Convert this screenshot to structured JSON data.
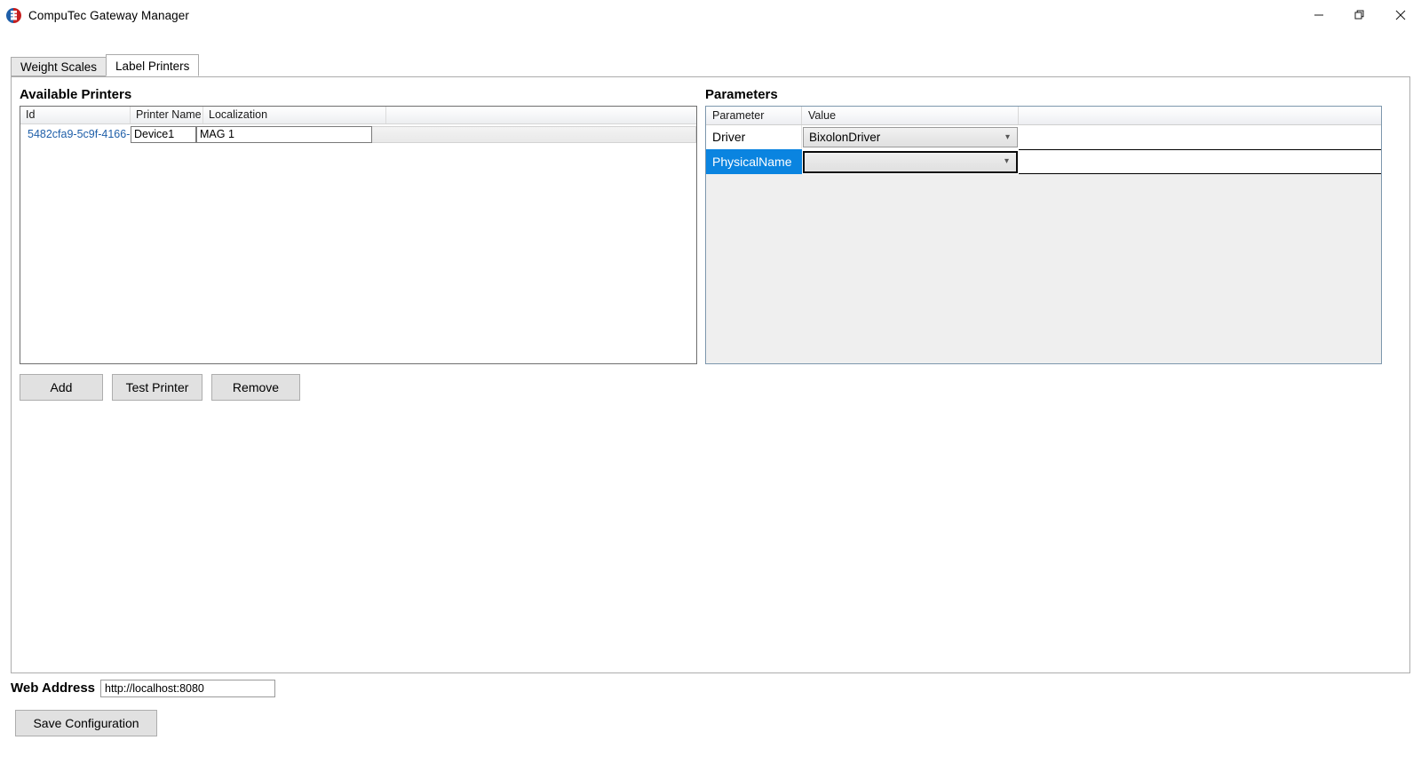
{
  "window": {
    "title": "CompuTec Gateway Manager",
    "icon": "app-logo-icon",
    "controls": {
      "minimize": "minimize-icon",
      "restore": "restore-icon",
      "close": "close-icon"
    }
  },
  "tabs": [
    {
      "label": "Weight Scales",
      "active": false
    },
    {
      "label": "Label Printers",
      "active": true
    }
  ],
  "available_printers": {
    "title": "Available Printers",
    "columns": [
      "Id",
      "Printer Name",
      "Localization",
      ""
    ],
    "rows": [
      {
        "id": "5482cfa9-5c9f-4166-",
        "printer_name": "Device1",
        "localization": "MAG 1"
      }
    ]
  },
  "buttons": {
    "add": "Add",
    "test_printer": "Test Printer",
    "remove": "Remove"
  },
  "parameters": {
    "title": "Parameters",
    "columns": [
      "Parameter",
      "Value",
      ""
    ],
    "rows": [
      {
        "parameter": "Driver",
        "value": "BixolonDriver",
        "selected": false
      },
      {
        "parameter": "PhysicalName",
        "value": "",
        "selected": true
      }
    ]
  },
  "footer": {
    "web_address_label": "Web Address",
    "web_address_value": "http://localhost:8080",
    "web_address_placeholder": "",
    "save_label": "Save Configuration"
  },
  "colors": {
    "selection_blue": "#0a84e0",
    "id_link_blue": "#1f5fa9",
    "button_face": "#e1e1e1",
    "panel_gray": "#efefef"
  }
}
